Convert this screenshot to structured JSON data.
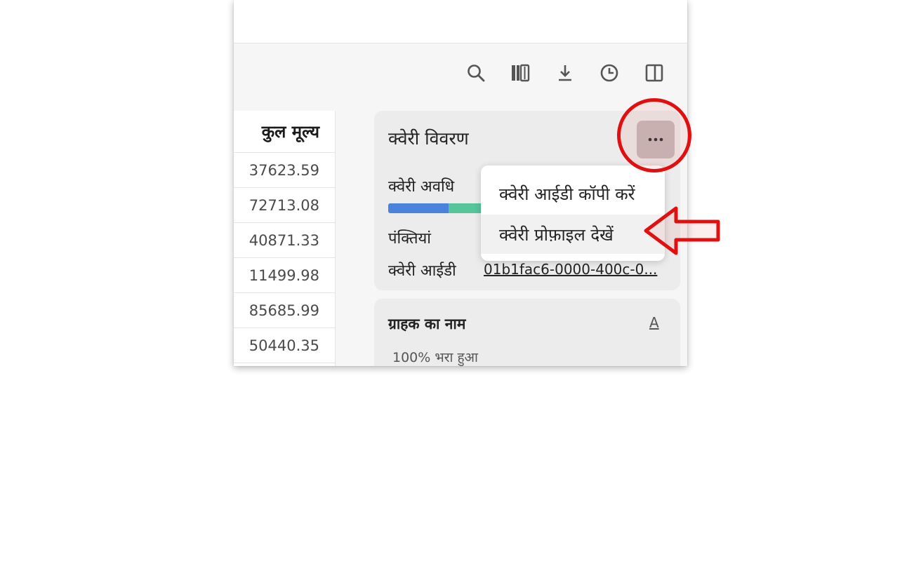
{
  "toolbar": {
    "icons": [
      "search-icon",
      "columns-icon",
      "download-icon",
      "history-icon",
      "split-panel-icon"
    ]
  },
  "table": {
    "header": "कुल मूल्य",
    "values": [
      "37623.59",
      "72713.08",
      "40871.33",
      "11499.98",
      "85685.99",
      "50440.35"
    ]
  },
  "query_details": {
    "title": "क्वेरी विवरण",
    "duration_label": "क्वेरी अवधि",
    "rows_label": "पंक्तियां",
    "query_id_label": "क्वेरी आईडी",
    "query_id_value": "01b1fac6-0000-400c-0...",
    "duration_bar": {
      "segment_fractions": [
        0.64,
        0.36
      ],
      "colors": [
        "#4a83dc",
        "#56c59a"
      ]
    },
    "more_icon": "ellipsis-icon"
  },
  "menu": {
    "items": [
      "क्वेरी आईडी कॉपी करें",
      "क्वेरी प्रोफ़ाइल देखें"
    ]
  },
  "column_card": {
    "title": "ग्राहक का नाम",
    "type_icon": "A",
    "fill_text": "100% भरा हुआ"
  },
  "annotation": {
    "color": "#e01010"
  }
}
